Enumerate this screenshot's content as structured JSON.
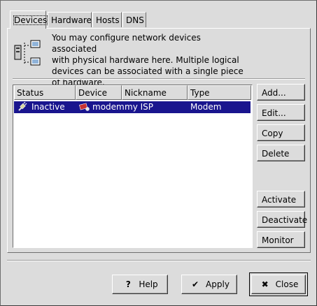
{
  "tabs": [
    "Devices",
    "Hardware",
    "Hosts",
    "DNS"
  ],
  "description": "You may configure network devices associated with physical hardware here. Multiple logical devices can be associated with a single piece of hardware.",
  "description_lines": [
    "You may configure network devices associated",
    "with physical hardware here. Multiple logical",
    "devices can be associated with a single piece",
    "of hardware."
  ],
  "list": {
    "columns": [
      "Status",
      "Device",
      "Nickname",
      "Type"
    ],
    "rows": [
      {
        "status": "Inactive",
        "device": "modem",
        "nickname": "my ISP",
        "type": "Modem"
      }
    ]
  },
  "side_buttons": {
    "add": "Add...",
    "edit": "Edit...",
    "copy": "Copy",
    "delete": "Delete",
    "activate": "Activate",
    "deactivate": "Deactivate",
    "monitor": "Monitor"
  },
  "bottom_buttons": {
    "help": "Help",
    "apply": "Apply",
    "close": "Close"
  },
  "colors": {
    "selection": "#19158e",
    "background": "#dcdcdc"
  }
}
